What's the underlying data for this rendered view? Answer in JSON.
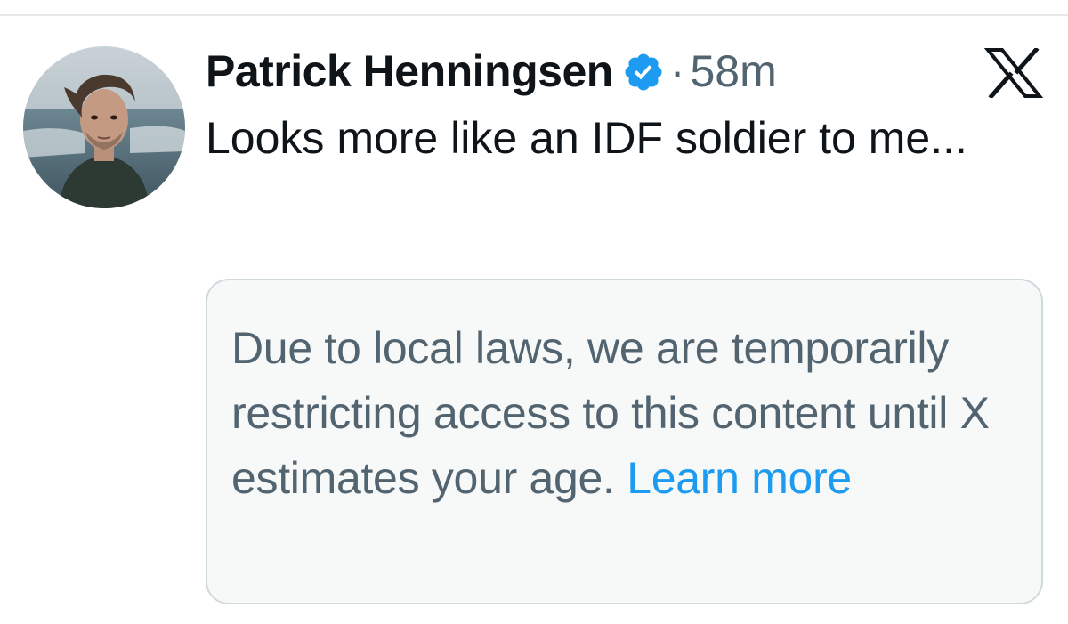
{
  "tweet": {
    "author_name": "Patrick Henningsen",
    "separator": "·",
    "timestamp": "58m",
    "text": "Looks more like an IDF soldier to me...",
    "verified": true,
    "badge_color": "#1d9bf0"
  },
  "platform": {
    "logo_icon": "x-logo-icon"
  },
  "notice": {
    "text": "Due to local laws, we are temporarily restricting access to this content until X estimates your age.",
    "link_label": "Learn more",
    "link_color": "#1d9bf0"
  },
  "colors": {
    "primary_text": "#0f1419",
    "secondary_text": "#536471",
    "card_background": "#f7f9f9",
    "card_border": "#cfd9de"
  }
}
